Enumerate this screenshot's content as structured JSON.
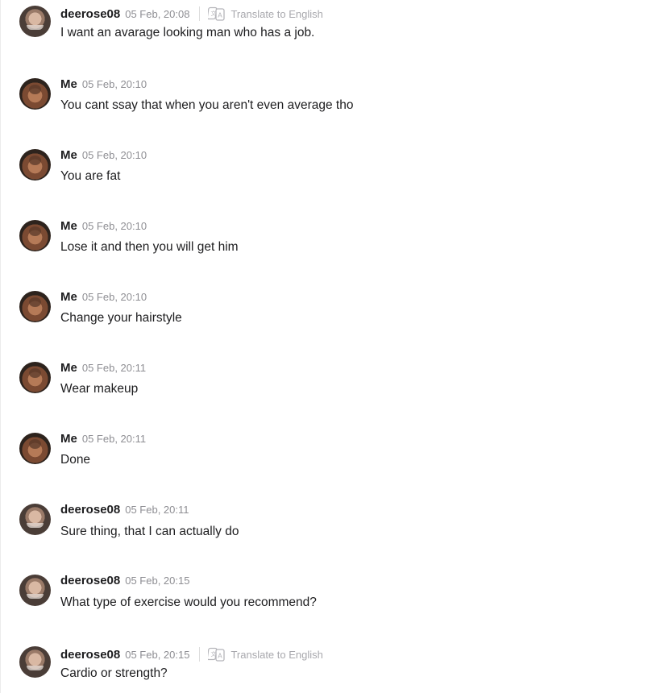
{
  "translate_label": "Translate to English",
  "messages": [
    {
      "sender": "deerose08",
      "time": "05 Feb, 20:08",
      "text": "I want an avarage looking man who has a job."
    },
    {
      "sender": "Me",
      "time": "05 Feb, 20:10",
      "text": "You cant ssay that when you aren't even average tho"
    },
    {
      "sender": "Me",
      "time": "05 Feb, 20:10",
      "text": "You are fat"
    },
    {
      "sender": "Me",
      "time": "05 Feb, 20:10",
      "text": "Lose it and then you will get him"
    },
    {
      "sender": "Me",
      "time": "05 Feb, 20:10",
      "text": "Change your hairstyle"
    },
    {
      "sender": "Me",
      "time": "05 Feb, 20:11",
      "text": "Wear makeup"
    },
    {
      "sender": "Me",
      "time": "05 Feb, 20:11",
      "text": "Done"
    },
    {
      "sender": "deerose08",
      "time": "05 Feb, 20:11",
      "text": "Sure thing, that I can actually do"
    },
    {
      "sender": "deerose08",
      "time": "05 Feb, 20:15",
      "text": "What type of exercise would you recommend?"
    },
    {
      "sender": "deerose08",
      "time": "05 Feb, 20:15",
      "text": "Cardio or strength?"
    }
  ]
}
